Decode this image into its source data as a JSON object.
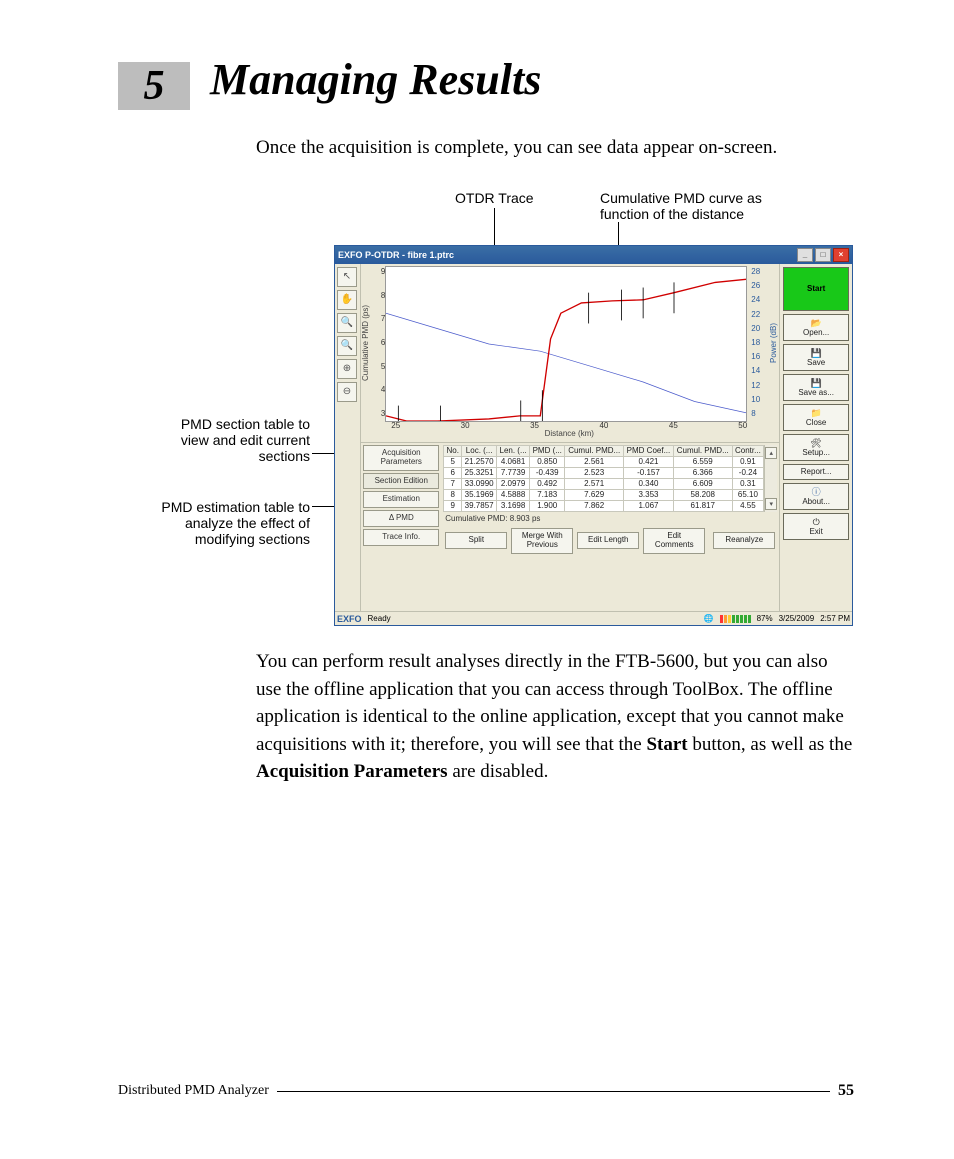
{
  "chapter": {
    "num": "5",
    "title": "Managing Results"
  },
  "intro": "Once the acquisition is complete, you can see data appear on-screen.",
  "annotations": {
    "otdr": "OTDR Trace",
    "cumcurve1": "Cumulative PMD curve as",
    "cumcurve2": "function of the distance",
    "sectiontable1": "PMD section table to",
    "sectiontable2": "view and edit current",
    "sectiontable3": "sections",
    "esttable1": "PMD estimation table to",
    "esttable2": "analyze the effect of",
    "esttable3": "modifying sections"
  },
  "window": {
    "title": "EXFO P-OTDR - fibre 1.ptrc",
    "toolbar_icons": [
      "↖",
      "✋",
      "🔍",
      "🔍",
      "⊕",
      "⊖"
    ],
    "chart": {
      "ylabel": "Cumulative PMD (ps)",
      "y2label": "Power (dB)",
      "xlabel": "Distance (km)",
      "yticks": [
        "9",
        "8",
        "7",
        "6",
        "5",
        "4",
        "3"
      ],
      "y2ticks": [
        "28",
        "26",
        "24",
        "22",
        "20",
        "18",
        "16",
        "14",
        "12",
        "10",
        "8"
      ],
      "xticks": [
        "25",
        "30",
        "35",
        "40",
        "45",
        "50"
      ]
    },
    "tabs": [
      "Acquisition\nParameters",
      "Section Edition",
      "Estimation",
      "Δ PMD",
      "Trace Info."
    ],
    "table": {
      "headers": [
        "No.",
        "Loc. (...",
        "Len. (...",
        "PMD (...",
        "Cumul. PMD...",
        "PMD Coef...",
        "Cumul. PMD...",
        "Contr..."
      ],
      "rows": [
        [
          "5",
          "21.2570",
          "4.0681",
          "0.850",
          "2.561",
          "0.421",
          "6.559",
          "0.91"
        ],
        [
          "6",
          "25.3251",
          "7.7739",
          "-0.439",
          "2.523",
          "-0.157",
          "6.366",
          "-0.24"
        ],
        [
          "7",
          "33.0990",
          "2.0979",
          "0.492",
          "2.571",
          "0.340",
          "6.609",
          "0.31"
        ],
        [
          "8",
          "35.1969",
          "4.5888",
          "7.183",
          "7.629",
          "3.353",
          "58.208",
          "65.10"
        ],
        [
          "9",
          "39.7857",
          "3.1698",
          "1.900",
          "7.862",
          "1.067",
          "61.817",
          "4.55"
        ]
      ]
    },
    "cumline": "Cumulative PMD: 8.903 ps",
    "section_buttons": [
      "Split",
      "Merge With\nPrevious",
      "Edit Length",
      "Edit\nComments"
    ],
    "reanalyze": "Reanalyze",
    "right_buttons": {
      "start": "Start",
      "open": "Open...",
      "save": "Save",
      "saveas": "Save as...",
      "close": "Close",
      "setup": "Setup...",
      "report": "Report...",
      "about": "About...",
      "exit": "Exit"
    },
    "status": {
      "brand": "EXFO",
      "state": "Ready",
      "pct": "87%",
      "date": "3/25/2009",
      "time": "2:57 PM"
    }
  },
  "outro": {
    "t1": "You can perform result analyses directly in the FTB-5600, but you can also use the offline application that you can access through ToolBox. The offline application is identical to the online application, except that you cannot make acquisitions with it; therefore, you will see that the ",
    "b1": "Start",
    "t2": " button, as well as the ",
    "b2": "Acquisition Parameters",
    "t3": " are disabled."
  },
  "footer": {
    "doc": "Distributed PMD Analyzer",
    "page": "55"
  },
  "chart_data": {
    "type": "line",
    "xlabel": "Distance (km)",
    "xlim": [
      20,
      55
    ],
    "series": [
      {
        "name": "Cumulative PMD (ps)",
        "axis": "left",
        "ylim": [
          3,
          9
        ],
        "color": "#d00000",
        "x": [
          20,
          22,
          25,
          30,
          33,
          35,
          36,
          37,
          39,
          42,
          45,
          48,
          52,
          55
        ],
        "y": [
          3.0,
          2.8,
          2.8,
          2.9,
          3.0,
          3.0,
          6.0,
          7.0,
          7.4,
          7.5,
          7.5,
          7.8,
          8.2,
          8.3
        ]
      },
      {
        "name": "Power (dB) — OTDR trace",
        "axis": "right",
        "ylim": [
          8,
          28
        ],
        "color": "#4a5acb",
        "x": [
          20,
          25,
          30,
          35,
          40,
          45,
          50,
          55
        ],
        "y": [
          22,
          20,
          18,
          17,
          15,
          13,
          10.5,
          9
        ]
      }
    ],
    "section_markers_x": [
      21.257,
      25.325,
      33.099,
      35.197,
      39.786,
      42.9,
      45,
      48
    ]
  }
}
